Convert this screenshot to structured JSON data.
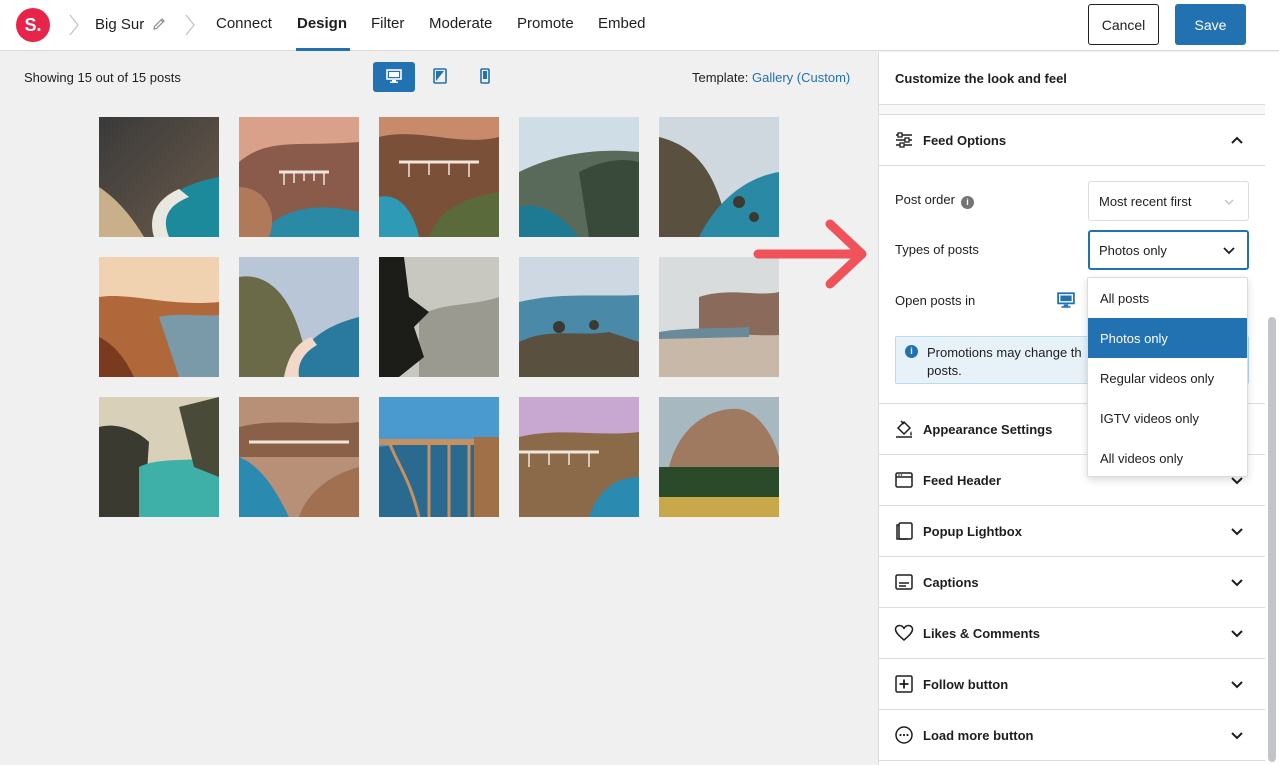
{
  "header": {
    "logo_text": "S.",
    "feed_name": "Big Sur",
    "tabs": [
      {
        "label": "Connect"
      },
      {
        "label": "Design"
      },
      {
        "label": "Filter"
      },
      {
        "label": "Moderate"
      },
      {
        "label": "Promote"
      },
      {
        "label": "Embed"
      }
    ],
    "active_tab": "Design",
    "cancel_label": "Cancel",
    "save_label": "Save"
  },
  "preview": {
    "showing_text": "Showing 15 out of 15 posts",
    "devices": [
      "desktop-icon",
      "tablet-icon",
      "phone-icon"
    ],
    "active_device": "desktop",
    "template_label": "Template:",
    "template_value": "Gallery (Custom)",
    "post_count": 15
  },
  "sidebar": {
    "title": "Customize the look and feel",
    "feed_options": {
      "title": "Feed Options",
      "post_order_label": "Post order",
      "post_order_value": "Most recent first",
      "types_label": "Types of posts",
      "types_value": "Photos only",
      "open_posts_label": "Open posts in",
      "notice_text": "Promotions may change th",
      "notice_text_2": "posts."
    },
    "dropdown_options": [
      {
        "label": "All posts"
      },
      {
        "label": "Photos only"
      },
      {
        "label": "Regular videos only"
      },
      {
        "label": "IGTV videos only"
      },
      {
        "label": "All videos only"
      }
    ],
    "dropdown_selected": "Photos only",
    "sections": [
      {
        "title": "Appearance Settings",
        "icon": "paint-bucket-icon"
      },
      {
        "title": "Feed Header",
        "icon": "window-header-icon"
      },
      {
        "title": "Popup Lightbox",
        "icon": "lightbox-icon"
      },
      {
        "title": "Captions",
        "icon": "captions-icon"
      },
      {
        "title": "Likes & Comments",
        "icon": "heart-icon"
      },
      {
        "title": "Follow button",
        "icon": "plus-square-icon"
      },
      {
        "title": "Load more button",
        "icon": "more-circle-icon"
      }
    ]
  },
  "colors": {
    "accent": "#2271b1",
    "logo": "#e8244a",
    "arrow": "#f0525a"
  }
}
